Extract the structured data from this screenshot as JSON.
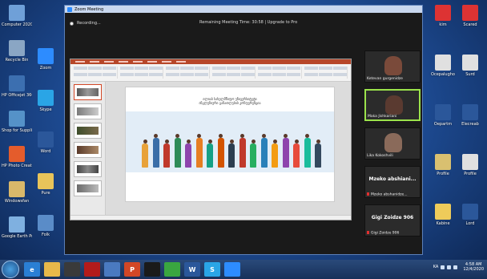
{
  "desktop_left": [
    {
      "label": "Computer 2020",
      "color": "#6fa0d8"
    },
    {
      "label": "Recycle Bin",
      "color": "#8aa6c4"
    },
    {
      "label": "HP Officejet 3600 series",
      "color": "#3c6fb0"
    },
    {
      "label": "Shop for Supplies",
      "color": "#5592c8"
    },
    {
      "label": "HP Photo Creations",
      "color": "#e45c2c"
    },
    {
      "label": "Windowsfan",
      "color": "#d9b86a"
    },
    {
      "label": "Google Earth Pro",
      "color": "#7fb0e0"
    }
  ],
  "desktop_left2": [
    {
      "label": "Zoom",
      "color": "#2d8cff"
    },
    {
      "label": "Skype",
      "color": "#2aa5e6"
    },
    {
      "label": "Word",
      "color": "#2b579a"
    },
    {
      "label": "Pure",
      "color": "#e8c45a"
    },
    {
      "label": "Folk",
      "color": "#5a8cc8"
    }
  ],
  "desktop_right": [
    {
      "label": "kim",
      "color": "#d33"
    },
    {
      "label": "Ocepalugho",
      "color": "#e0e0e0"
    },
    {
      "label": "Oepartm",
      "color": "#2b579a"
    },
    {
      "label": "Profile",
      "color": "#d9c070"
    },
    {
      "label": "Kabine",
      "color": "#eecb5a"
    },
    {
      "label": "Scared",
      "color": "#d33"
    },
    {
      "label": "Surd",
      "color": "#e0e0e0"
    },
    {
      "label": "Elecreab",
      "color": "#2b579a"
    },
    {
      "label": "Profile",
      "color": "#e0e0e0"
    },
    {
      "label": "Lord",
      "color": "#2b579a"
    }
  ],
  "zoom": {
    "window_title": "Zoom Meeting",
    "recording_label": "Recording...",
    "remaining_text": "Remaining Meeting Time: 30:58 | Upgrade to Pro"
  },
  "slide": {
    "title_line1": "ილიას სახელმწიფო უნივერსიტეტი",
    "title_line2": "ინკლუზიური განათლების კონფერენცია"
  },
  "participants": [
    {
      "name": "Ketevan gurgenidze",
      "speaking": false,
      "face": "#7a4a3a"
    },
    {
      "name": "Maka Jishkariani",
      "speaking": true,
      "face": "#5a3a30"
    },
    {
      "name": "Lika Kokoshvili",
      "speaking": false,
      "face": "#8a6a5a"
    },
    {
      "name": "Mzeko abshiani...",
      "muted_name": "Mzeko abshanidze...",
      "speaking": false
    },
    {
      "name": "Gigi Zoidze 906",
      "muted_name": "Gigi Zoidze 906",
      "speaking": false
    }
  ],
  "taskbar": {
    "apps": [
      {
        "name": "ie",
        "color": "#2a7fd4",
        "glyph": "e"
      },
      {
        "name": "explorer",
        "color": "#e8b84a",
        "glyph": ""
      },
      {
        "name": "media",
        "color": "#3a3a3a",
        "glyph": ""
      },
      {
        "name": "acrobat",
        "color": "#b31b1b",
        "glyph": ""
      },
      {
        "name": "paint",
        "color": "#4a7ac0",
        "glyph": ""
      },
      {
        "name": "powerpoint",
        "color": "#d24726",
        "glyph": "P"
      },
      {
        "name": "skype",
        "color": "#1a1a1a",
        "glyph": ""
      },
      {
        "name": "chrome",
        "color": "#3aa640",
        "glyph": ""
      },
      {
        "name": "word",
        "color": "#2b579a",
        "glyph": "W"
      },
      {
        "name": "skype2",
        "color": "#2aa5e6",
        "glyph": "S"
      },
      {
        "name": "zoom",
        "color": "#2d8cff",
        "glyph": ""
      }
    ],
    "language": "KA",
    "time": "4:58 AM",
    "date": "12/4/2020"
  }
}
